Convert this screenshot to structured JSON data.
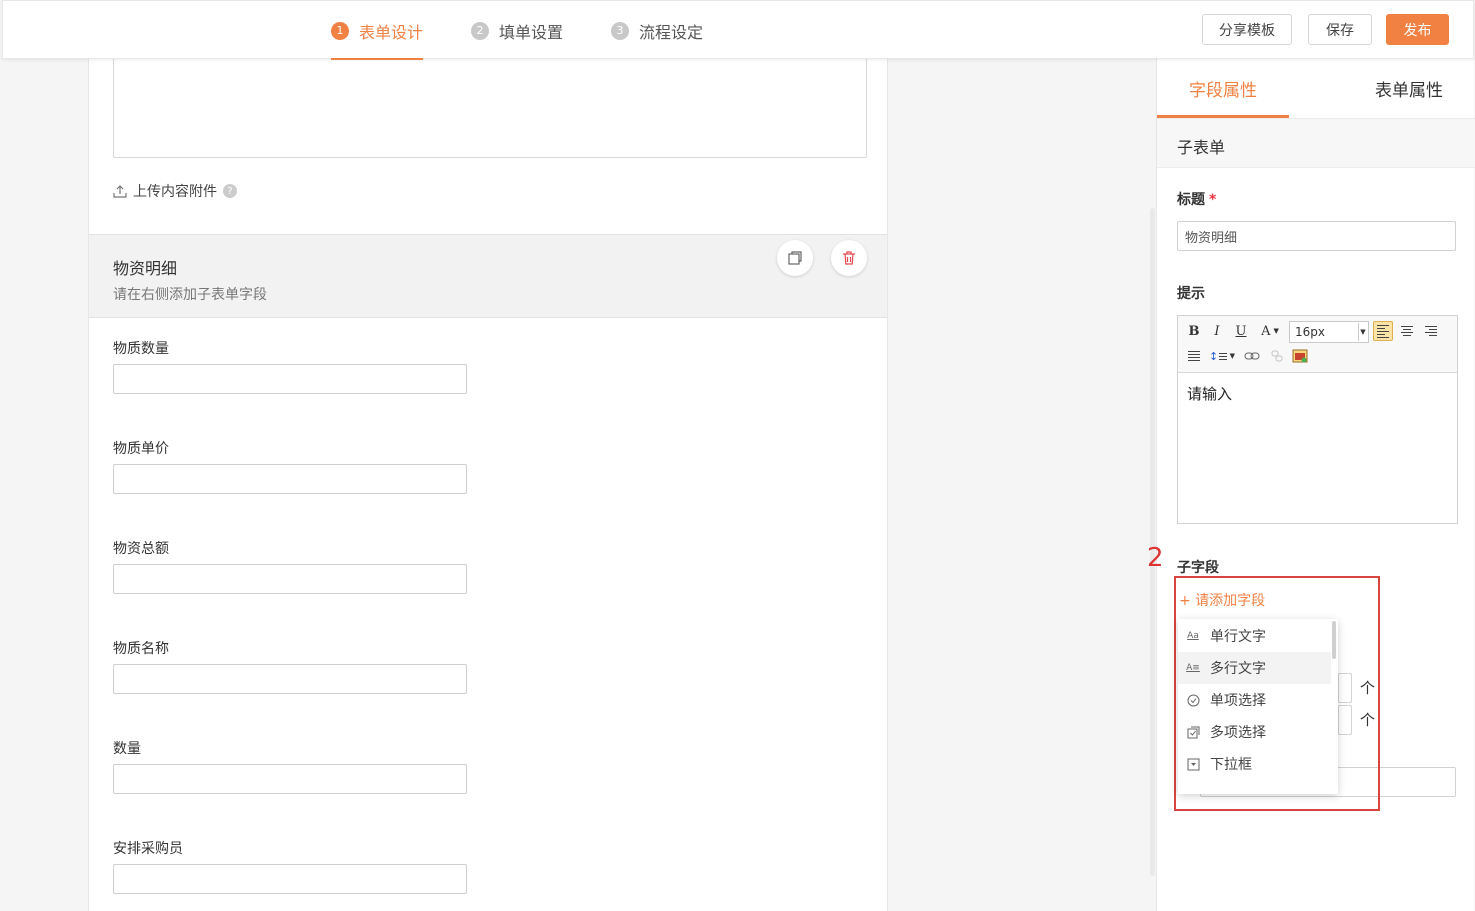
{
  "steps": [
    {
      "num": "1",
      "label": "表单设计"
    },
    {
      "num": "2",
      "label": "填单设置"
    },
    {
      "num": "3",
      "label": "流程设定"
    }
  ],
  "actions": {
    "share": "分享模板",
    "save": "保存",
    "publish": "发布"
  },
  "canvas": {
    "upload_label": "上传内容附件",
    "help_glyph": "?",
    "subform": {
      "title": "物资明细",
      "hint": "请在右侧添加子表单字段"
    },
    "fields": [
      "物质数量",
      "物质单价",
      "物资总额",
      "物质名称",
      "数量",
      "安排采购员"
    ]
  },
  "panel": {
    "tabs": [
      "字段属性",
      "表单属性"
    ],
    "section_title": "子表单",
    "title_label": "标题",
    "required_mark": "*",
    "title_value": "物资明细",
    "hint_label": "提示",
    "font_size": "16px",
    "editor_text": "请输入",
    "subfield_label": "子字段",
    "add_field": "+ 请添加字段",
    "field_types": [
      {
        "icon": "Aa",
        "label": "单行文字"
      },
      {
        "icon": "A≡",
        "label": "多行文字"
      },
      {
        "icon": "radio-icon",
        "label": "单项选择"
      },
      {
        "icon": "checkbox-icon",
        "label": "多项选择"
      },
      {
        "icon": "dropdown-icon",
        "label": "下拉框"
      }
    ],
    "arrow_glyph": "个"
  },
  "annotation": "2",
  "colors": {
    "accent": "#f08142",
    "annotation": "#d9443f",
    "danger": "#e5484d"
  }
}
